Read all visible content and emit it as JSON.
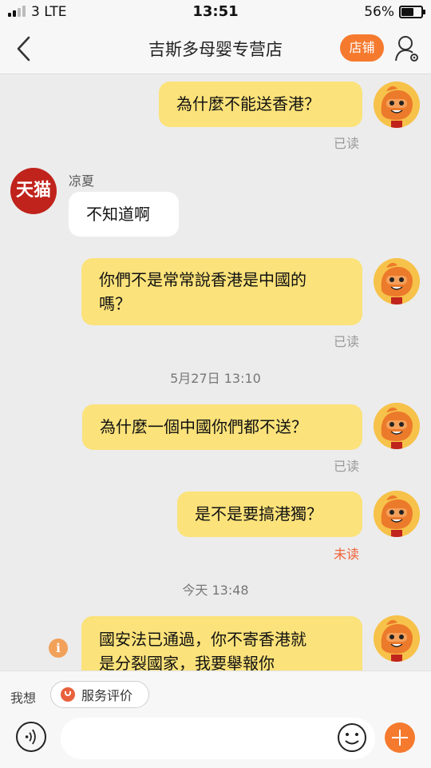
{
  "status_bar": {
    "carrier": "3 LTE",
    "time": "13:51",
    "battery": "56%",
    "battery_level": 0.56
  },
  "nav": {
    "title": "吉斯多母婴专营店",
    "shop_label": "店铺"
  },
  "messages": [
    {
      "from": "me",
      "text": "為什麼不能送香港？",
      "status": "已读"
    },
    {
      "from": "them",
      "sender": "凉夏",
      "avatar_text": "天猫",
      "text": "不知道啊"
    },
    {
      "from": "me",
      "text_line1": "你們不是常常說香港是中國的",
      "text_line2": "嗎？",
      "status": "已读"
    },
    {
      "timestamp": "5月27日 13:10"
    },
    {
      "from": "me",
      "text": "為什麼一個中國你們都不送？",
      "status": "已读"
    },
    {
      "from": "me",
      "text": "是不是要搞港獨？",
      "status": "未读"
    },
    {
      "timestamp": "今天 13:48"
    },
    {
      "from": "me",
      "text_line1": "國安法已通過，你不寄香港就",
      "text_line2": "是分裂國家，我要舉報你",
      "info": "i"
    }
  ],
  "bottom_bar": {
    "want_label": "我想",
    "service_label": "服务评价"
  },
  "colors": {
    "accent": "#f57a2e",
    "my_bubble": "#fbe27a",
    "unread": "#f0623a",
    "tmall_red": "#c0231c"
  }
}
